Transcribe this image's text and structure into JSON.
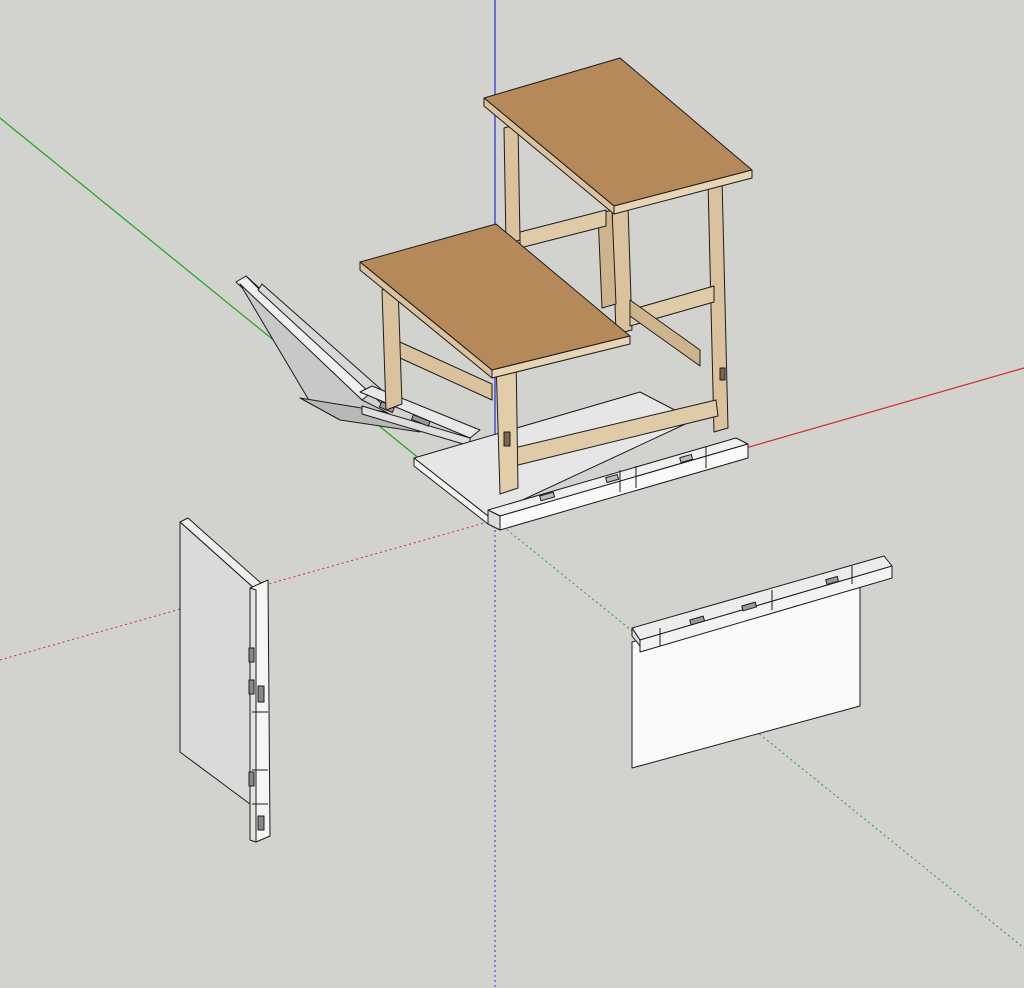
{
  "app": {
    "view": "3d-model-viewport"
  },
  "scene": {
    "background_color": "#d2d2cf",
    "axes": {
      "red": "#d22c2c",
      "green": "#1ea51e",
      "blue": "#2a2ae0"
    },
    "wood_top_color": "#b5895a",
    "wood_side_color": "#d9c29d",
    "panel_light_color": "#f7f7f7",
    "panel_shade_color": "#c9c9c9",
    "edge_color": "#1c1c1c"
  }
}
